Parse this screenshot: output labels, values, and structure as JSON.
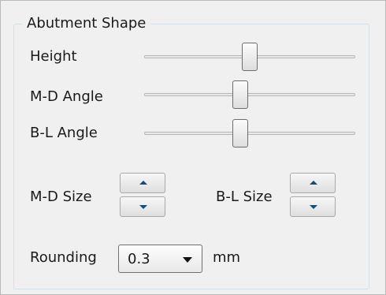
{
  "group": {
    "title": "Abutment Shape"
  },
  "sliders": [
    {
      "label": "Height",
      "value": 0.5
    },
    {
      "label": "M-D Angle",
      "value": 0.45
    },
    {
      "label": "B-L Angle",
      "value": 0.45
    }
  ],
  "md_size": {
    "label": "M-D Size",
    "up_icon": "arrow-up-icon",
    "down_icon": "arrow-down-icon"
  },
  "bl_size": {
    "label": "B-L Size",
    "up_icon": "arrow-up-icon",
    "down_icon": "arrow-down-icon"
  },
  "rounding": {
    "label": "Rounding",
    "value": "0.3",
    "unit": "mm",
    "icon": "chevron-down-icon"
  }
}
